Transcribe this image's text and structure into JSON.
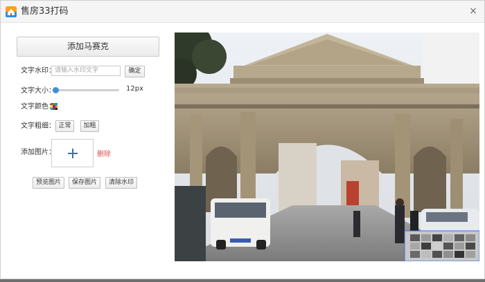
{
  "window": {
    "title": "售房33打码",
    "close_glyph": "×"
  },
  "controls": {
    "mosaic_button": "添加马赛克",
    "watermark_label": "文字水印：",
    "watermark_placeholder": "请输入水印文字",
    "confirm_button": "确定",
    "size_label": "文字大小：",
    "size_value": "12px",
    "size_fraction": 0.05,
    "color_label": "文字颜色：",
    "weight_label": "文字粗细：",
    "weight_normal": "正常",
    "weight_bold": "加粗",
    "add_image_label": "添加图片：",
    "delete_link": "删除",
    "preview_button": "预览图片",
    "save_button": "保存图片",
    "clear_button": "清除水印"
  },
  "colors": {
    "accent": "#3d8fd6",
    "delete": "#d9534f",
    "swatch": [
      "#e53935",
      "#43a047",
      "#1e88e5",
      "#fdd835",
      "#8e24aa",
      "#fb8c00",
      "#00acc1",
      "#6d4c41",
      "#212121"
    ]
  },
  "icons": {
    "app": "house-icon",
    "close": "close-icon",
    "add": "plus-icon",
    "palette": "color-grid-icon"
  }
}
